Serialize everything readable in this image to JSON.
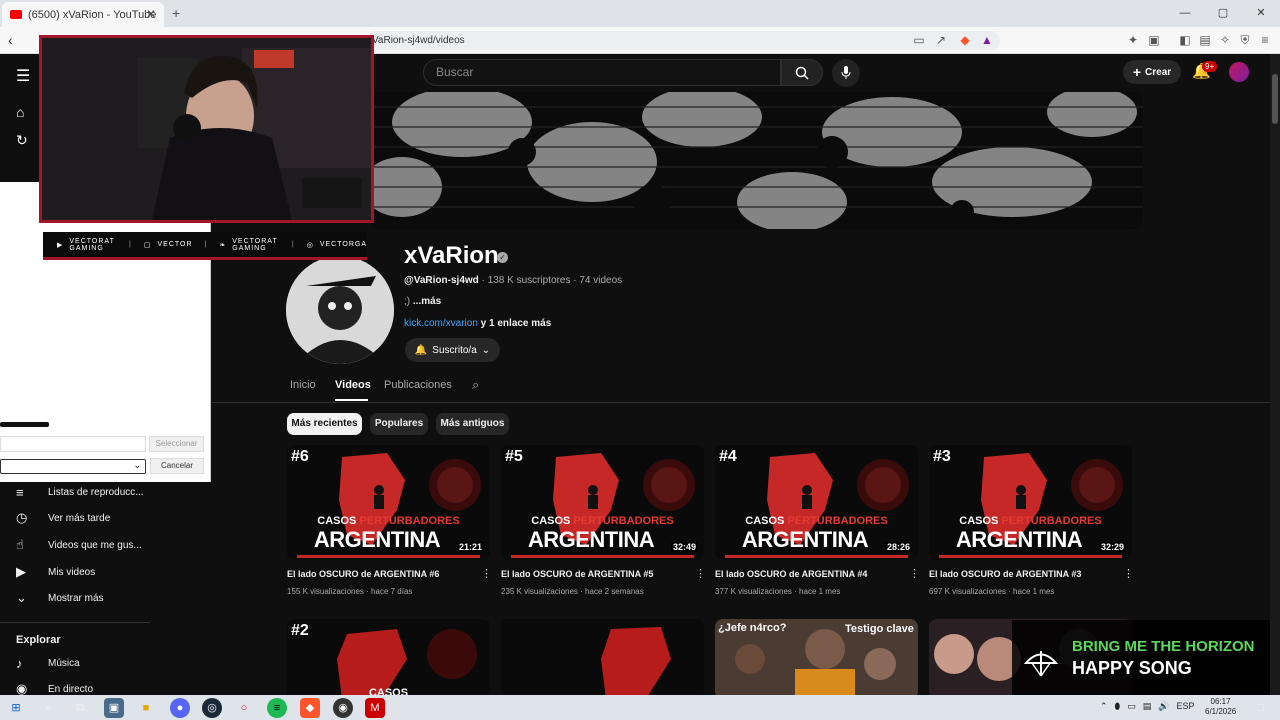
{
  "browser": {
    "tab_title": "(6500) xVaRion - YouTube",
    "tab_close": "✕",
    "new_tab": "+",
    "url": "VaRion-sj4wd/videos",
    "win_min": "—",
    "win_max": "▢",
    "win_close": "✕"
  },
  "youtube": {
    "search_placeholder": "Buscar",
    "create_label": "Crear",
    "notification_badge": "9+"
  },
  "sidebar": {
    "items": [
      {
        "label": "Listas de reproducc...",
        "icon": "playlist-icon"
      },
      {
        "label": "Ver más tarde",
        "icon": "clock-icon"
      },
      {
        "label": "Videos que me gus...",
        "icon": "thumb-up-icon"
      },
      {
        "label": "Mis videos",
        "icon": "play-box-icon"
      },
      {
        "label": "Mostrar más",
        "icon": "chevron-down-icon"
      }
    ],
    "section_title": "Explorar",
    "explore_items": [
      {
        "label": "Música",
        "icon": "music-icon"
      },
      {
        "label": "En directo",
        "icon": "live-icon"
      }
    ]
  },
  "channel": {
    "name": "xVaRion",
    "handle": "@VaRion-sj4wd",
    "stats": " · 138 K suscriptores · 74 videos",
    "description": ";)",
    "more": " ...más",
    "link": "kick.com/xvarion",
    "more_links": " y 1 enlace más",
    "subscribe_label": "Suscrito/a",
    "tabs": [
      "Inicio",
      "Videos",
      "Publicaciones"
    ],
    "active_tab": "Videos",
    "chips": [
      "Más recientes",
      "Populares",
      "Más antiguos"
    ],
    "active_chip": "Más recientes"
  },
  "videos": [
    {
      "num": "#6",
      "duration": "21:21",
      "title": "El lado OSCURO de ARGENTINA #6",
      "meta": "155 K visualizaciones · hace 7 días",
      "casos": "CASOS",
      "pert": "PERTURBADORES",
      "big": "ARGENTINA"
    },
    {
      "num": "#5",
      "duration": "32:49",
      "title": "El lado OSCURO de ARGENTINA #5",
      "meta": "235 K visualizaciones · hace 2 semanas",
      "casos": "CASOS",
      "pert": "PERTURBADORES",
      "big": "ARGENTINA"
    },
    {
      "num": "#4",
      "duration": "28:26",
      "title": "El lado OSCURO de ARGENTINA #4",
      "meta": "377 K visualizaciones · hace 1 mes",
      "casos": "CASOS",
      "pert": "PERTURBADORES",
      "big": "ARGENTINA"
    },
    {
      "num": "#3",
      "duration": "32:29",
      "title": "El lado OSCURO de ARGENTINA #3",
      "meta": "697 K visualizaciones · hace 1 mes",
      "casos": "CASOS",
      "pert": "PERTURBADORES",
      "big": "ARGENTINA"
    }
  ],
  "row2": {
    "num": "#2",
    "casos": "CASOS",
    "jefe": "¿Jefe n4rco?",
    "testigo": "Testigo clave"
  },
  "overlay": {
    "socials": [
      {
        "icon": "youtube-icon",
        "label": "VECTORAT GAMING"
      },
      {
        "icon": "twitch-icon",
        "label": "VECTOR"
      },
      {
        "icon": "twitter-icon",
        "label": "VECTORAT GAMING"
      },
      {
        "icon": "instagram-icon",
        "label": "VECTORGA"
      }
    ],
    "select_button": "Seleccionar",
    "cancel_button": "Cancelar"
  },
  "now_playing": {
    "line1": "BRING ME THE HORIZON",
    "line2": "HAPPY SONG"
  },
  "taskbar": {
    "lang": "ESP",
    "time": "06:17",
    "date": "6/1/2026"
  },
  "colors": {
    "accent_red": "#a3162a",
    "yt_bg": "#0f0f0f",
    "link_blue": "#3ea6ff",
    "np_green": "#5cd65c"
  }
}
